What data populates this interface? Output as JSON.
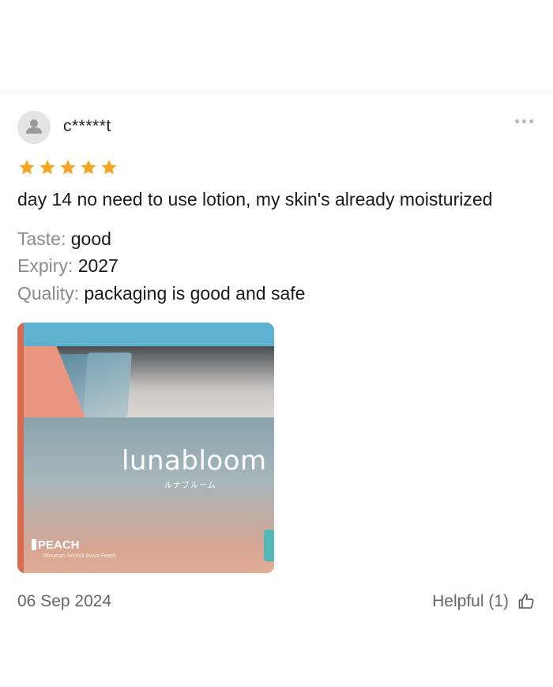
{
  "review": {
    "username": "c*****t",
    "rating": 5,
    "rating_max": 5,
    "text": "day 14 no need to use lotion, my skin's already moisturized",
    "attributes": [
      {
        "key": "Taste:",
        "value": "good"
      },
      {
        "key": "Expiry:",
        "value": "2027"
      },
      {
        "key": "Quality:",
        "value": "packaging is good and safe"
      }
    ],
    "photo": {
      "brand": "lunabloom",
      "brand_jp": "ルナブルーム",
      "flavor": "PEACH",
      "flavor_sub": "Minuman Serbuk Rasa Peach"
    },
    "date": "06 Sep 2024",
    "helpful_label": "Helpful (1)"
  },
  "colors": {
    "star": "#f5a623",
    "muted_text": "#8a8a8a",
    "body_text": "#1a1a1a"
  },
  "icons": {
    "avatar": "user-icon",
    "more": "more-horizontal-icon",
    "helpful": "thumbs-up-icon",
    "star": "star-icon"
  }
}
